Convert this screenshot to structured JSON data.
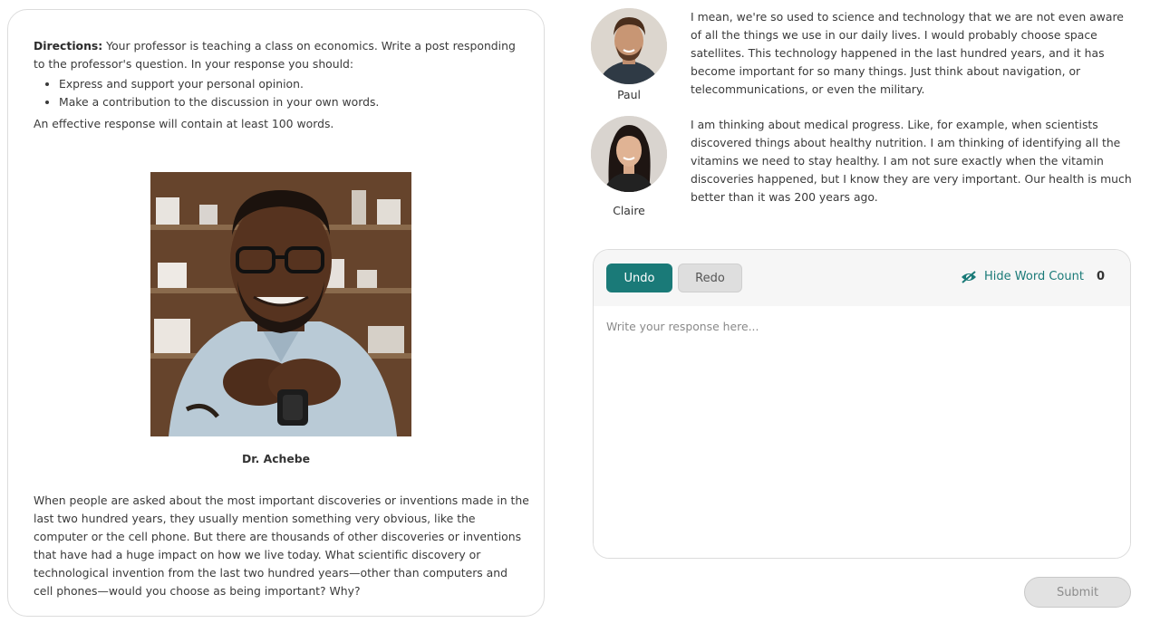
{
  "directions": {
    "label": "Directions:",
    "text": " Your professor is teaching a class on economics. Write a post responding to the professor's question. In your response you should:",
    "bullets": [
      "Express and support your personal opinion.",
      "Make a contribution to the discussion in your own words."
    ],
    "effective": "An effective response will contain at least 100 words."
  },
  "professor": {
    "name": "Dr. Achebe",
    "question": "When people are asked about the most important discoveries or inventions made in the last two hundred years, they usually mention something very obvious, like the computer or the cell phone. But there are thousands of other discoveries or inventions that have had a huge impact on how we live today. What scientific discovery or technological invention from the last two hundred years—other than computers and cell phones—would you choose as being important? Why?"
  },
  "students": [
    {
      "name": "Paul",
      "text": "I mean, we're so used to science and technology that we are not even aware of all the things we use in our daily lives. I would probably choose space satellites. This technology happened in the last hundred years, and it has become important for so many things. Just think about navigation, or telecommunications, or even the military."
    },
    {
      "name": "Claire",
      "text": "I am thinking about medical progress. Like, for example, when scientists discovered things about healthy nutrition. I am thinking of identifying all the vitamins we need to stay healthy. I am not sure exactly when the vitamin discoveries happened, but I know they are very important. Our health is much better than it was 200 years ago."
    }
  ],
  "editor": {
    "undo_label": "Undo",
    "redo_label": "Redo",
    "hide_word_count_label": "Hide Word Count",
    "word_count": "0",
    "placeholder": "Write your response here...",
    "value": ""
  },
  "submit_label": "Submit",
  "colors": {
    "accent": "#1a7a78",
    "disabled_bg": "#e2e2e2",
    "border": "#dcdcdc"
  },
  "icons": {
    "word_count_toggle": "eye-slash-icon"
  }
}
